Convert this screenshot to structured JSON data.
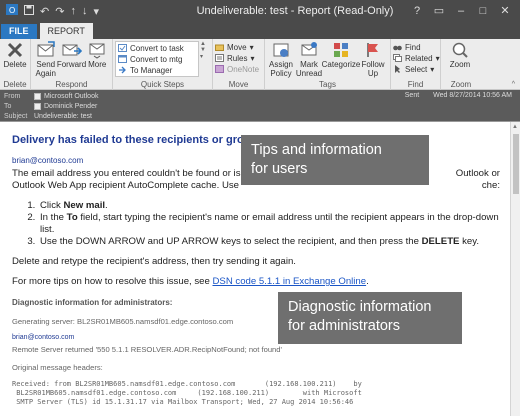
{
  "window": {
    "title": "Undeliverable: test - Report  (Read-Only)",
    "controls": [
      "?",
      "▭",
      "–",
      "□",
      "✕"
    ]
  },
  "tabs": {
    "file": "FILE",
    "report": "REPORT"
  },
  "ribbon": {
    "delete_group": {
      "label": "Delete",
      "delete": "Delete"
    },
    "respond_group": {
      "label": "Respond",
      "send_again": "Send Again",
      "forward": "Forward",
      "more": "More"
    },
    "quick_steps": {
      "label": "Quick Steps",
      "items": [
        "Convert to task",
        "Convert to mtg",
        "To Manager"
      ]
    },
    "move_group": {
      "label": "Move",
      "move": "Move",
      "rules": "Rules",
      "onenote": "OneNote"
    },
    "tags_group": {
      "label": "Tags",
      "assign_policy": "Assign Policy",
      "mark_unread": "Mark Unread",
      "categorize": "Categorize",
      "follow_up": "Follow Up"
    },
    "find_group": {
      "label": "Find",
      "find": "Find",
      "related": "Related",
      "select": "Select"
    },
    "zoom_group": {
      "label": "Zoom",
      "zoom": "Zoom"
    }
  },
  "header": {
    "from_label": "From",
    "from_value": "Microsoft Outlook",
    "to_label": "To",
    "to_value": "Dominick Pender",
    "subject_label": "Subject",
    "subject_value": "Undeliverable: test",
    "sent_label": "Sent",
    "sent_value": "Wed 8/27/2014 10:56 AM"
  },
  "body": {
    "heading": "Delivery has failed to these recipients or groups:",
    "recipient": "brian@contoso.com",
    "para1": "The email address you entered couldn't be found or is invalid. Please check the recipient's email address and try to resend the message. If the problem continues, please contact your helpdesk. Outlook or Outlook Web App recipient AutoComplete cache. Use the following steps to remove the address from the AutoComplete cache:",
    "para1_line1": "The email address you entered couldn't be found or is",
    "para1_line1_end": "Outlook or",
    "para1_line2": "Outlook Web App recipient AutoComplete cache. Use",
    "para1_line2_end": "che:",
    "step1_pre": "Click ",
    "step1_bold": "New mail",
    "step1_post": ".",
    "step2_pre": "In the ",
    "step2_bold": "To",
    "step2_post": " field, start typing the recipient's name or email address until the recipient appears in the drop-down list.",
    "step3_pre": "Use the DOWN ARROW and UP ARROW keys to select the recipient, and then press the ",
    "step3_bold": "DELETE",
    "step3_post": " key.",
    "para2": "Delete and retype the recipient's address, then try sending it again.",
    "para3_pre": "For more tips on how to resolve this issue, see ",
    "para3_link": "DSN code 5.1.1 in Exchange Online",
    "para3_post": ".",
    "diag_title": "Diagnostic information for administrators:",
    "generating_server": "Generating server: BL2SR01MB605.namsdf01.edge.contoso.com",
    "diag_email": "brian@contoso.com",
    "remote_server": "Remote Server returned '550 5.1.1 RESOLVER.ADR.RecipNotFound; not found'",
    "orig_headers": "Original message headers:",
    "mono1": "Received: from BL2SR01MB605.namsdf01.edge.contoso.com       (192.168.100.211)    by",
    "mono2": " BL2SR01MB605.namsdf01.edge.contoso.com     (192.168.100.211)        with Microsoft",
    "mono3": " SMTP Server (TLS) id 15.1.31.17 via Mailbox Transport; Wed, 27 Aug 2014 10:56:46"
  },
  "callouts": {
    "tips": "Tips and information for users",
    "tips_line1": "Tips and information",
    "tips_line2": "for users",
    "diag_line1": "Diagnostic information",
    "diag_line2": "for administrators"
  }
}
